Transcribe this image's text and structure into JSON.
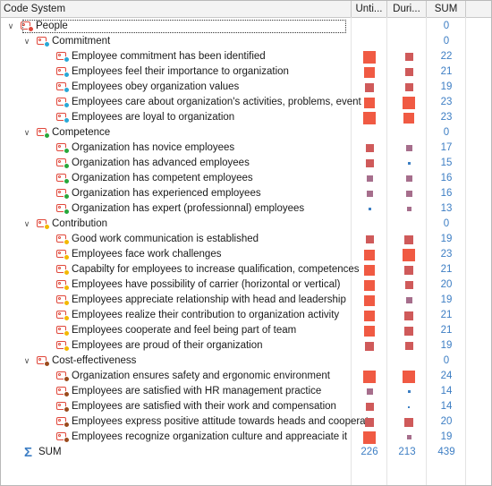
{
  "header": {
    "code_system": "Code System",
    "col1": "Unti...",
    "col2": "Duri...",
    "col3": "SUM"
  },
  "colors": {
    "people": "#e0473a",
    "commitment": "#29a8d6",
    "competence": "#27a83b",
    "contribution": "#f3b800",
    "cost": "#9a4a1c",
    "link": "#3d7ec4",
    "square": "#cf5a5a",
    "square_hot": "#f05a43",
    "square_blue": "#3c7fc3"
  },
  "rows": [
    {
      "label": "People",
      "level": 0,
      "color": "people",
      "sum": "0",
      "expanded": true,
      "selected": true
    },
    {
      "label": "Commitment",
      "level": 1,
      "color": "commitment",
      "sum": "0",
      "expanded": true
    },
    {
      "label": "Employee commitment has been identified",
      "level": 2,
      "color": "commitment",
      "sum": "22",
      "u": 12,
      "d": 9
    },
    {
      "label": "Employees feel their importance to organization",
      "level": 2,
      "color": "commitment",
      "sum": "21",
      "u": 11,
      "d": 9
    },
    {
      "label": "Employees obey organization values",
      "level": 2,
      "color": "commitment",
      "sum": "19",
      "u": 10,
      "d": 9
    },
    {
      "label": "Employees care about organization's activities, problems, event",
      "level": 2,
      "color": "commitment",
      "sum": "23",
      "u": 11,
      "d": 12
    },
    {
      "label": "Employees are loyal to organization",
      "level": 2,
      "color": "commitment",
      "sum": "23",
      "u": 12,
      "d": 11
    },
    {
      "label": "Competence",
      "level": 1,
      "color": "competence",
      "sum": "0",
      "expanded": true
    },
    {
      "label": "Organization has novice employees",
      "level": 2,
      "color": "competence",
      "sum": "17",
      "u": 9,
      "d": 8
    },
    {
      "label": "Organization has advanced employees",
      "level": 2,
      "color": "competence",
      "sum": "15",
      "u": 9,
      "d": 6
    },
    {
      "label": "Organization has competent employees",
      "level": 2,
      "color": "competence",
      "sum": "16",
      "u": 8,
      "d": 8
    },
    {
      "label": "Organization has experienced employees",
      "level": 2,
      "color": "competence",
      "sum": "16",
      "u": 8,
      "d": 8
    },
    {
      "label": "Organization has expert (professionnal) employees",
      "level": 2,
      "color": "competence",
      "sum": "13",
      "u": 6,
      "d": 7
    },
    {
      "label": "Contribution",
      "level": 1,
      "color": "contribution",
      "sum": "0",
      "expanded": true
    },
    {
      "label": "Good work communication is established",
      "level": 2,
      "color": "contribution",
      "sum": "19",
      "u": 9,
      "d": 10
    },
    {
      "label": "Employees face work challenges",
      "level": 2,
      "color": "contribution",
      "sum": "23",
      "u": 11,
      "d": 12
    },
    {
      "label": "Capabilty for employees to increase qualification, competences",
      "level": 2,
      "color": "contribution",
      "sum": "21",
      "u": 11,
      "d": 10
    },
    {
      "label": "Employees have possibility of carrier (horizontal or vertical)",
      "level": 2,
      "color": "contribution",
      "sum": "20",
      "u": 11,
      "d": 9
    },
    {
      "label": "Employees appreciate relationship with head and leadership",
      "level": 2,
      "color": "contribution",
      "sum": "19",
      "u": 11,
      "d": 8
    },
    {
      "label": "Employees realize their contribution to organization activity",
      "level": 2,
      "color": "contribution",
      "sum": "21",
      "u": 11,
      "d": 10
    },
    {
      "label": "Employees cooperate and feel being part of team",
      "level": 2,
      "color": "contribution",
      "sum": "21",
      "u": 11,
      "d": 10
    },
    {
      "label": "Employees are proud of their organization",
      "level": 2,
      "color": "contribution",
      "sum": "19",
      "u": 10,
      "d": 9
    },
    {
      "label": "Cost-effectiveness",
      "level": 1,
      "color": "cost",
      "sum": "0",
      "expanded": true
    },
    {
      "label": "Organization ensures safety and ergonomic environment",
      "level": 2,
      "color": "cost",
      "sum": "24",
      "u": 12,
      "d": 12
    },
    {
      "label": "Employees are satisfied with HR management practice",
      "level": 2,
      "color": "cost",
      "sum": "14",
      "u": 8,
      "d": 6
    },
    {
      "label": "Employees are satisfied with their work and compensation",
      "level": 2,
      "color": "cost",
      "sum": "14",
      "u": 9,
      "d": 5
    },
    {
      "label": "Employees express positive attitude towards heads and cooperat",
      "level": 2,
      "color": "cost",
      "sum": "20",
      "u": 10,
      "d": 10
    },
    {
      "label": "Employees recognize organization culture and appreaciate it",
      "level": 2,
      "color": "cost",
      "sum": "19",
      "u": 12,
      "d": 7
    }
  ],
  "totals": {
    "label": "SUM",
    "symbol": "Σ",
    "col1": "226",
    "col2": "213",
    "col3": "439"
  }
}
